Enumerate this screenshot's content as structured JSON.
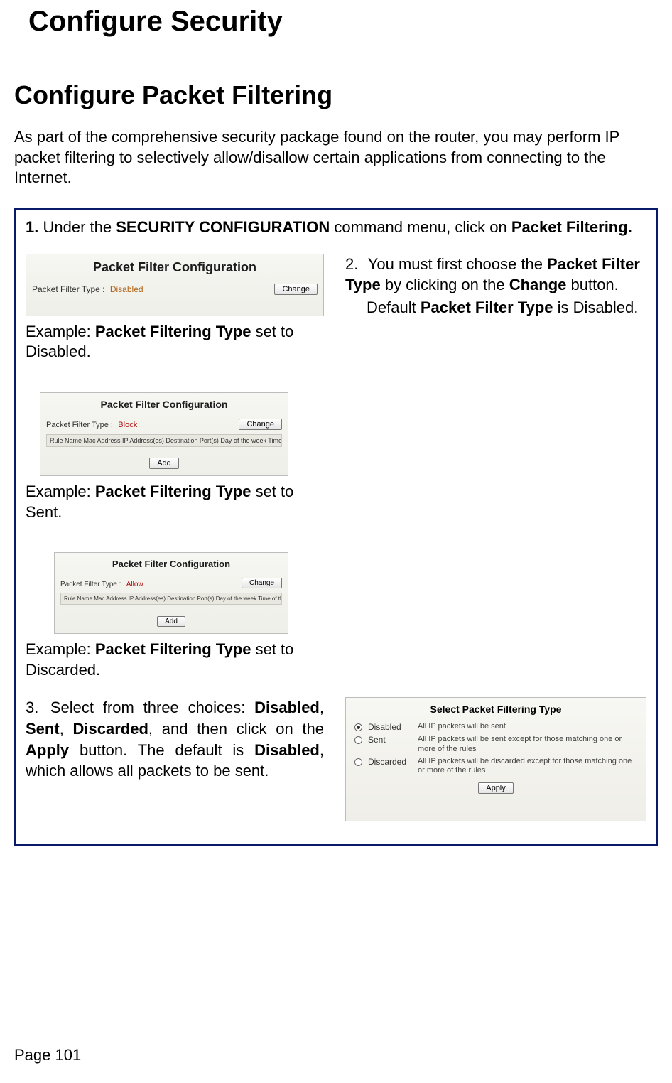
{
  "chapter_title": "Configure Security",
  "section_title": "Configure Packet Filtering",
  "intro": "As part of the comprehensive security package found on the router, you may perform IP packet filtering to selectively allow/disallow certain applications from connecting to the Internet.",
  "step1": {
    "num": "1.",
    "before": "Under the ",
    "bold1": "SECURITY CONFIGURATION",
    "mid": " command menu, click on ",
    "bold2": "Packet Filtering.",
    "after": ""
  },
  "panel_title": "Packet Filter Configuration",
  "panel_label": "Packet Filter Type :",
  "values": {
    "disabled": "Disabled",
    "block": "Block",
    "allow": "Allow"
  },
  "change_btn": "Change",
  "add_btn": "Add",
  "table_columns": "Rule Name  Mac Address  IP Address(es)  Destination Port(s)  Day of the week  Time of the Day",
  "captions": {
    "disabled_a": "Example: ",
    "disabled_b": "Packet Filtering Type",
    "disabled_c": " set to Disabled.",
    "sent_a": "Example: ",
    "sent_b": "Packet Filtering Type",
    "sent_c": " set to Sent.",
    "discarded_a": "Example: ",
    "discarded_b": "Packet Filtering Type",
    "discarded_c": " set to Discarded."
  },
  "step2": {
    "num": "2.",
    "a": "You must first choose the ",
    "b1": "Packet Filter Type",
    "c": " by clicking on the ",
    "b2": "Change",
    "d": " button.",
    "e": "Default ",
    "b3": "Packet Filter Type",
    "f": " is Disabled."
  },
  "step3": {
    "num": "3.",
    "a": "Select from three choices: ",
    "b1": "Disabled",
    "c1": ", ",
    "b2": "Sent",
    "c2": ", ",
    "b3": "Discarded",
    "d": ", and then click on the ",
    "b4": "Apply",
    "e": " button. The default is ",
    "b5": "Disabled",
    "f": ", which allows all packets to be sent."
  },
  "select_panel": {
    "title": "Select Packet Filtering Type",
    "opts": [
      {
        "label": "Disabled",
        "desc": "All IP packets will be sent"
      },
      {
        "label": "Sent",
        "desc": "All IP packets will be sent except for those matching one or more of the rules"
      },
      {
        "label": "Discarded",
        "desc": "All IP packets will be discarded except for those matching one or more of the rules"
      }
    ],
    "apply": "Apply"
  },
  "page_number": "Page 101"
}
